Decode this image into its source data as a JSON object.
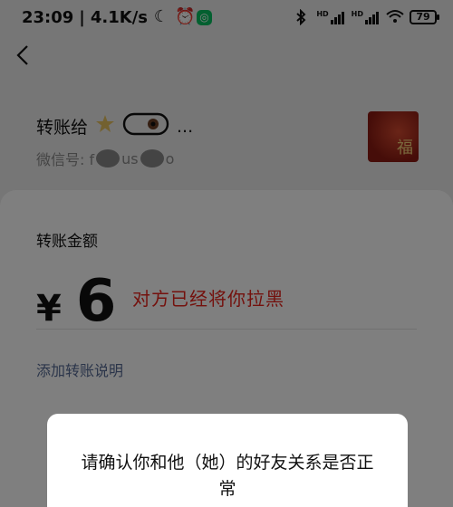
{
  "status_bar": {
    "time": "23:09",
    "net_speed": "4.1K/s",
    "battery": "79",
    "icons": [
      "moon-icon",
      "alarm-icon",
      "app-badge-icon",
      "bluetooth-icon",
      "hd-signal-icon",
      "hd-signal-icon",
      "wifi-icon",
      "battery-icon"
    ]
  },
  "header": {
    "back_icon": "chevron-left-icon"
  },
  "payee": {
    "prefix": "转账给",
    "name_suffix": "...",
    "wechat_id_label": "微信号: f",
    "wechat_id_mid": "us",
    "wechat_id_end": "o",
    "avatar_text": "福"
  },
  "transfer": {
    "amount_label": "转账金额",
    "currency": "¥",
    "amount": "6",
    "annotation": "对方已经将你拉黑",
    "add_note": "添加转账说明"
  },
  "dialog": {
    "message": "请确认你和他（她）的好友关系是否正常"
  },
  "colors": {
    "link": "#576b95",
    "annotation_red": "#e8231a",
    "wechat_green": "#07c160"
  }
}
